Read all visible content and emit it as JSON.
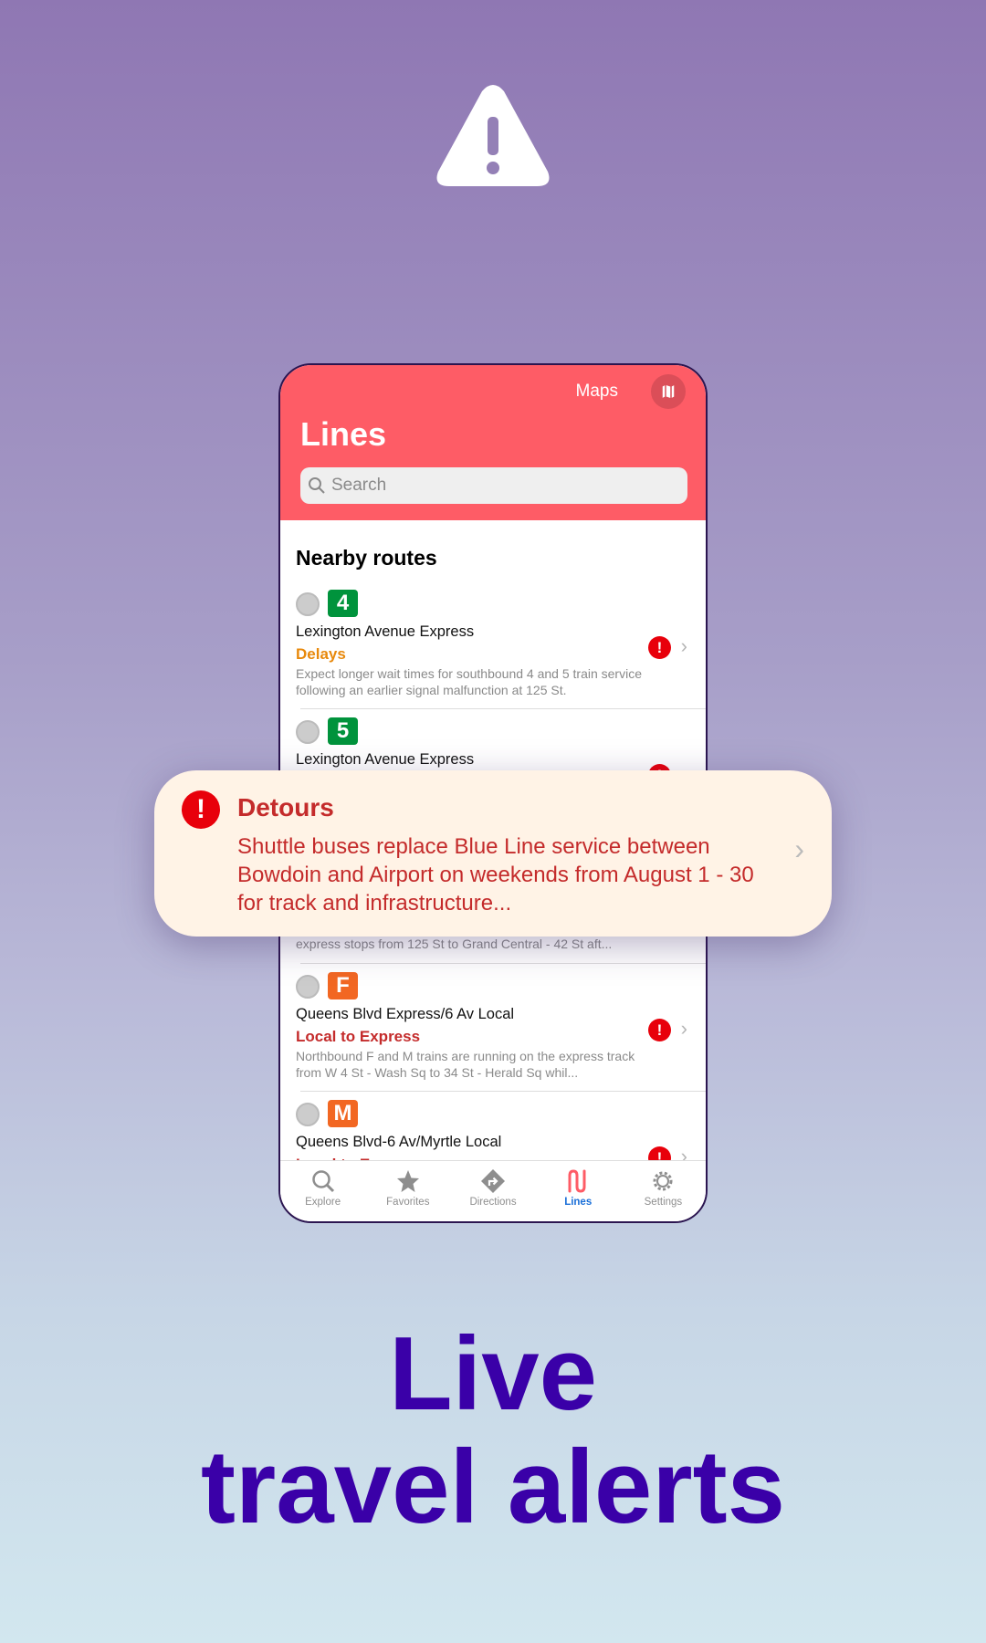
{
  "hero_icon": "warning-triangle-icon",
  "app": {
    "maps_label": "Maps",
    "title": "Lines",
    "search_placeholder": "Search",
    "section": "Nearby routes",
    "routes": [
      {
        "badge": "4",
        "badge_color": "#00933c",
        "name": "Lexington Avenue Express",
        "status": "Delays",
        "status_color": "#e8890c",
        "desc": "Expect longer wait times for southbound 4 and 5 train service following an earlier signal malfunction at 125 St."
      },
      {
        "badge": "5",
        "badge_color": "#00933c",
        "name": "Lexington Avenue Express",
        "desc": "express stops from 125 St to Grand Central - 42 St aft..."
      },
      {
        "badge": "F",
        "badge_color": "#f26722",
        "name": "Queens Blvd Express/6 Av Local",
        "status": "Local to Express",
        "status_color": "#c42b2b",
        "desc": "Northbound F and M trains are running on the express track from W 4 St - Wash Sq to 34 St - Herald Sq whil..."
      },
      {
        "badge": "M",
        "badge_color": "#f26722",
        "name": "Queens Blvd-6 Av/Myrtle Local",
        "status": "Local to Express",
        "status_color": "#c42b2b"
      }
    ],
    "tabs": [
      {
        "label": "Explore",
        "icon": "search-icon"
      },
      {
        "label": "Favorites",
        "icon": "star-icon"
      },
      {
        "label": "Directions",
        "icon": "directions-icon"
      },
      {
        "label": "Lines",
        "icon": "lines-icon",
        "active": true
      },
      {
        "label": "Settings",
        "icon": "gear-icon"
      }
    ]
  },
  "popup": {
    "title": "Detours",
    "text": "Shuttle buses replace Blue Line service between Bowdoin and Airport on weekends from August 1 - 30 for track and infrastructure..."
  },
  "headline": {
    "line1": "Live",
    "line2": "travel alerts"
  },
  "colors": {
    "header": "#fe5c66",
    "accent": "#3a00a8",
    "alert": "#e8000b"
  }
}
